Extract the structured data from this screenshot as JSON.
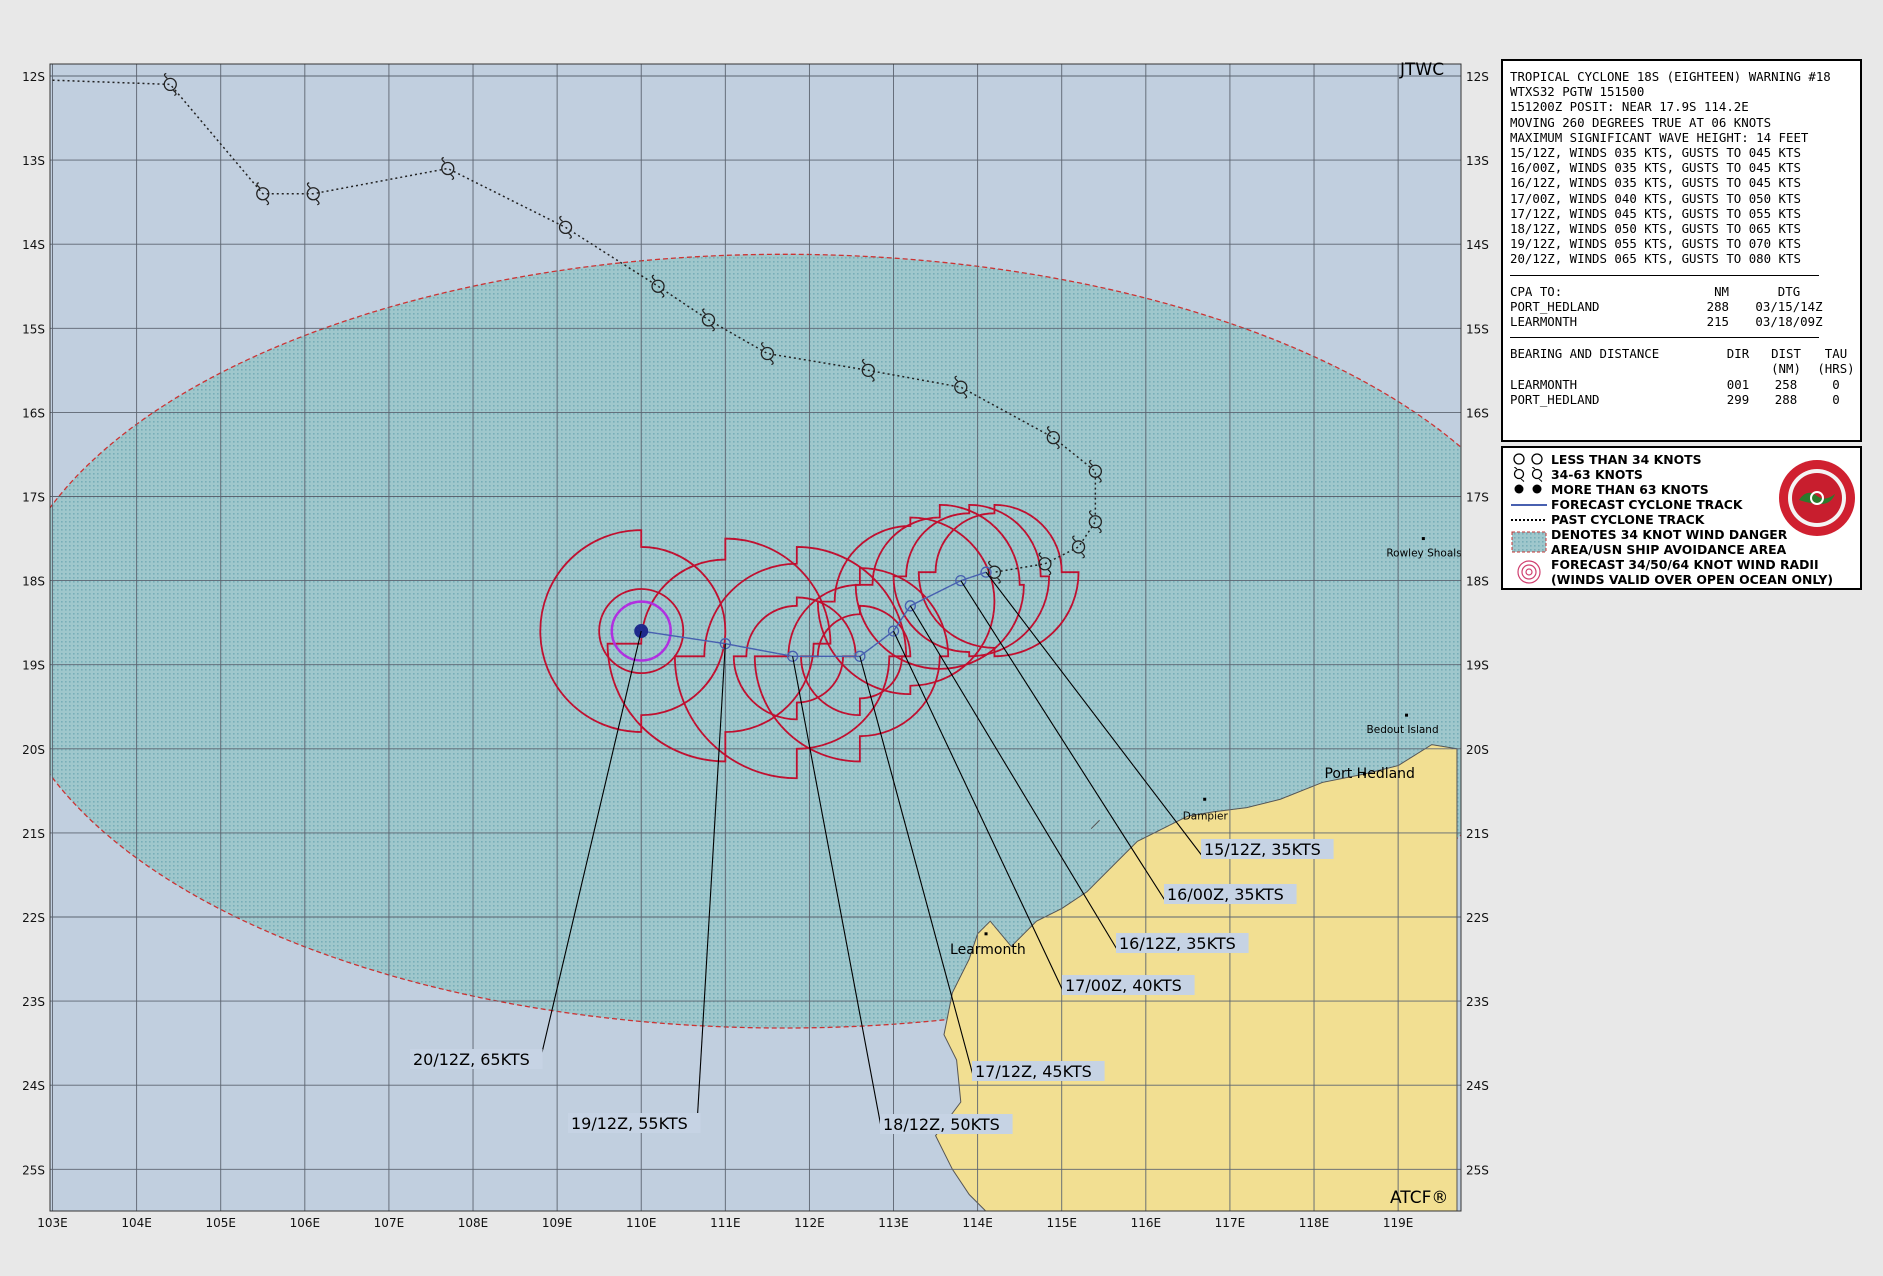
{
  "map": {
    "corner_top": "JTWC",
    "corner_bottom": "ATCF®",
    "lat_labels": [
      "12S",
      "13S",
      "14S",
      "15S",
      "16S",
      "17S",
      "18S",
      "19S",
      "20S",
      "21S",
      "22S",
      "23S",
      "24S",
      "25S"
    ],
    "lon_labels": [
      "103E",
      "104E",
      "105E",
      "106E",
      "107E",
      "108E",
      "109E",
      "110E",
      "111E",
      "112E",
      "113E",
      "114E",
      "115E",
      "116E",
      "117E",
      "118E",
      "119E"
    ],
    "places": [
      {
        "name": "Rowley Shoals",
        "lon": 119.3,
        "lat": 17.5
      },
      {
        "name": "Bedout Island",
        "lon": 119.1,
        "lat": 19.6
      },
      {
        "name": "Port Hedland",
        "lon": 118.6,
        "lat": 20.3
      },
      {
        "name": "Dampier",
        "lon": 116.7,
        "lat": 20.6
      },
      {
        "name": "Learmonth",
        "lon": 114.1,
        "lat": 22.2
      }
    ],
    "forecast_labels": [
      {
        "text": "15/12Z,  35KTS",
        "lon": 114.1,
        "lat": 17.9
      },
      {
        "text": "16/00Z,  35KTS",
        "lon": 113.8,
        "lat": 18.0
      },
      {
        "text": "16/12Z,  35KTS",
        "lon": 113.2,
        "lat": 18.3
      },
      {
        "text": "17/00Z,  40KTS",
        "lon": 113.0,
        "lat": 18.6
      },
      {
        "text": "17/12Z,  45KTS",
        "lon": 112.6,
        "lat": 18.9
      },
      {
        "text": "18/12Z,  50KTS",
        "lon": 111.8,
        "lat": 18.9
      },
      {
        "text": "19/12Z,  55KTS",
        "lon": 111.0,
        "lat": 18.75
      },
      {
        "text": "20/12Z,  65KTS",
        "lon": 110.0,
        "lat": 18.6
      }
    ],
    "colors": {
      "ocean": "#c1cfdf",
      "land": "#f2df92",
      "danger": "#8dbec6",
      "wind_radii": "#c01030",
      "track": "#4860b0",
      "grid": "#5c6470"
    }
  },
  "info": {
    "lines": [
      "TROPICAL CYCLONE 18S (EIGHTEEN) WARNING #18",
      "WTXS32 PGTW 151500",
      "151200Z POSIT: NEAR 17.9S 114.2E",
      "MOVING 260 DEGREES TRUE AT 06 KNOTS",
      "MAXIMUM SIGNIFICANT WAVE HEIGHT: 14 FEET",
      "15/12Z, WINDS 035 KTS, GUSTS TO 045 KTS",
      "16/00Z, WINDS 035 KTS, GUSTS TO 045 KTS",
      "16/12Z, WINDS 035 KTS, GUSTS TO 045 KTS",
      "17/00Z, WINDS 040 KTS, GUSTS TO 050 KTS",
      "17/12Z, WINDS 045 KTS, GUSTS TO 055 KTS",
      "18/12Z, WINDS 050 KTS, GUSTS TO 065 KTS",
      "19/12Z, WINDS 055 KTS, GUSTS TO 070 KTS",
      "20/12Z, WINDS 065 KTS, GUSTS TO 080 KTS"
    ],
    "cpa_header": {
      "to": "CPA TO:",
      "nm": "NM",
      "dtg": "DTG"
    },
    "cpa": [
      {
        "place": "PORT_HEDLAND",
        "nm": "288",
        "dtg": "03/15/14Z"
      },
      {
        "place": "LEARMONTH",
        "nm": "215",
        "dtg": "03/18/09Z"
      }
    ],
    "bearing_header": {
      "title": "BEARING AND DISTANCE",
      "dir": "DIR",
      "dist": "DIST",
      "tau": "TAU",
      "dist_unit": "(NM)",
      "tau_unit": "(HRS)"
    },
    "bearing": [
      {
        "place": "LEARMONTH",
        "dir": "001",
        "dist": "258",
        "tau": "0"
      },
      {
        "place": "PORT_HEDLAND",
        "dir": "299",
        "dist": "288",
        "tau": "0"
      }
    ]
  },
  "legend": {
    "items": [
      "LESS THAN 34 KNOTS",
      "34-63 KNOTS",
      "MORE THAN 63 KNOTS",
      "FORECAST CYCLONE TRACK",
      "PAST CYCLONE TRACK",
      "DENOTES 34 KNOT WIND DANGER",
      "AREA/USN SHIP AVOIDANCE AREA",
      "FORECAST 34/50/64 KNOT WIND RADII",
      "(WINDS VALID OVER OPEN OCEAN ONLY)"
    ],
    "seal_icon": "jtwc-seal-icon"
  }
}
